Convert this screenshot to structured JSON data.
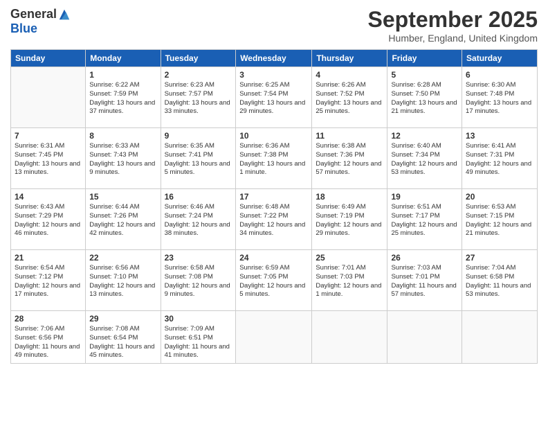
{
  "logo": {
    "general": "General",
    "blue": "Blue"
  },
  "title": "September 2025",
  "location": "Humber, England, United Kingdom",
  "days_of_week": [
    "Sunday",
    "Monday",
    "Tuesday",
    "Wednesday",
    "Thursday",
    "Friday",
    "Saturday"
  ],
  "weeks": [
    [
      {
        "day": "",
        "info": ""
      },
      {
        "day": "1",
        "info": "Sunrise: 6:22 AM\nSunset: 7:59 PM\nDaylight: 13 hours\nand 37 minutes."
      },
      {
        "day": "2",
        "info": "Sunrise: 6:23 AM\nSunset: 7:57 PM\nDaylight: 13 hours\nand 33 minutes."
      },
      {
        "day": "3",
        "info": "Sunrise: 6:25 AM\nSunset: 7:54 PM\nDaylight: 13 hours\nand 29 minutes."
      },
      {
        "day": "4",
        "info": "Sunrise: 6:26 AM\nSunset: 7:52 PM\nDaylight: 13 hours\nand 25 minutes."
      },
      {
        "day": "5",
        "info": "Sunrise: 6:28 AM\nSunset: 7:50 PM\nDaylight: 13 hours\nand 21 minutes."
      },
      {
        "day": "6",
        "info": "Sunrise: 6:30 AM\nSunset: 7:48 PM\nDaylight: 13 hours\nand 17 minutes."
      }
    ],
    [
      {
        "day": "7",
        "info": "Sunrise: 6:31 AM\nSunset: 7:45 PM\nDaylight: 13 hours\nand 13 minutes."
      },
      {
        "day": "8",
        "info": "Sunrise: 6:33 AM\nSunset: 7:43 PM\nDaylight: 13 hours\nand 9 minutes."
      },
      {
        "day": "9",
        "info": "Sunrise: 6:35 AM\nSunset: 7:41 PM\nDaylight: 13 hours\nand 5 minutes."
      },
      {
        "day": "10",
        "info": "Sunrise: 6:36 AM\nSunset: 7:38 PM\nDaylight: 13 hours\nand 1 minute."
      },
      {
        "day": "11",
        "info": "Sunrise: 6:38 AM\nSunset: 7:36 PM\nDaylight: 12 hours\nand 57 minutes."
      },
      {
        "day": "12",
        "info": "Sunrise: 6:40 AM\nSunset: 7:34 PM\nDaylight: 12 hours\nand 53 minutes."
      },
      {
        "day": "13",
        "info": "Sunrise: 6:41 AM\nSunset: 7:31 PM\nDaylight: 12 hours\nand 49 minutes."
      }
    ],
    [
      {
        "day": "14",
        "info": "Sunrise: 6:43 AM\nSunset: 7:29 PM\nDaylight: 12 hours\nand 46 minutes."
      },
      {
        "day": "15",
        "info": "Sunrise: 6:44 AM\nSunset: 7:26 PM\nDaylight: 12 hours\nand 42 minutes."
      },
      {
        "day": "16",
        "info": "Sunrise: 6:46 AM\nSunset: 7:24 PM\nDaylight: 12 hours\nand 38 minutes."
      },
      {
        "day": "17",
        "info": "Sunrise: 6:48 AM\nSunset: 7:22 PM\nDaylight: 12 hours\nand 34 minutes."
      },
      {
        "day": "18",
        "info": "Sunrise: 6:49 AM\nSunset: 7:19 PM\nDaylight: 12 hours\nand 29 minutes."
      },
      {
        "day": "19",
        "info": "Sunrise: 6:51 AM\nSunset: 7:17 PM\nDaylight: 12 hours\nand 25 minutes."
      },
      {
        "day": "20",
        "info": "Sunrise: 6:53 AM\nSunset: 7:15 PM\nDaylight: 12 hours\nand 21 minutes."
      }
    ],
    [
      {
        "day": "21",
        "info": "Sunrise: 6:54 AM\nSunset: 7:12 PM\nDaylight: 12 hours\nand 17 minutes."
      },
      {
        "day": "22",
        "info": "Sunrise: 6:56 AM\nSunset: 7:10 PM\nDaylight: 12 hours\nand 13 minutes."
      },
      {
        "day": "23",
        "info": "Sunrise: 6:58 AM\nSunset: 7:08 PM\nDaylight: 12 hours\nand 9 minutes."
      },
      {
        "day": "24",
        "info": "Sunrise: 6:59 AM\nSunset: 7:05 PM\nDaylight: 12 hours\nand 5 minutes."
      },
      {
        "day": "25",
        "info": "Sunrise: 7:01 AM\nSunset: 7:03 PM\nDaylight: 12 hours\nand 1 minute."
      },
      {
        "day": "26",
        "info": "Sunrise: 7:03 AM\nSunset: 7:01 PM\nDaylight: 11 hours\nand 57 minutes."
      },
      {
        "day": "27",
        "info": "Sunrise: 7:04 AM\nSunset: 6:58 PM\nDaylight: 11 hours\nand 53 minutes."
      }
    ],
    [
      {
        "day": "28",
        "info": "Sunrise: 7:06 AM\nSunset: 6:56 PM\nDaylight: 11 hours\nand 49 minutes."
      },
      {
        "day": "29",
        "info": "Sunrise: 7:08 AM\nSunset: 6:54 PM\nDaylight: 11 hours\nand 45 minutes."
      },
      {
        "day": "30",
        "info": "Sunrise: 7:09 AM\nSunset: 6:51 PM\nDaylight: 11 hours\nand 41 minutes."
      },
      {
        "day": "",
        "info": ""
      },
      {
        "day": "",
        "info": ""
      },
      {
        "day": "",
        "info": ""
      },
      {
        "day": "",
        "info": ""
      }
    ]
  ]
}
